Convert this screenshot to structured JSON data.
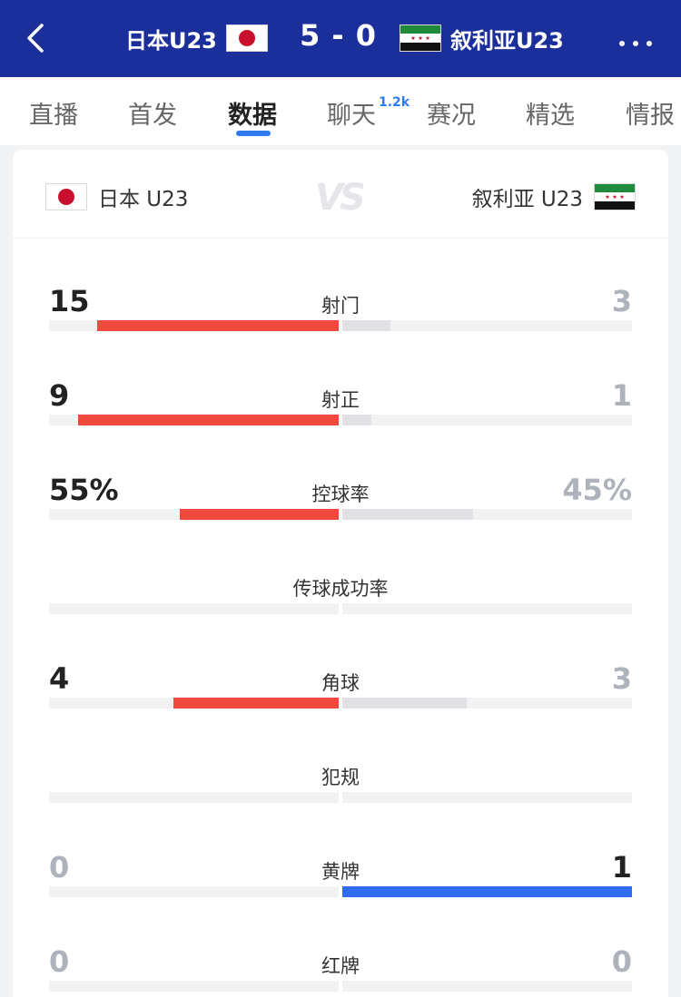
{
  "header": {
    "home_team": "日本U23",
    "away_team": "叙利亚U23",
    "score": "5 - 0",
    "icons": {
      "back": "back-arrow-icon",
      "more": "more-dots-icon"
    }
  },
  "tabs": [
    {
      "label": "直播"
    },
    {
      "label": "首发"
    },
    {
      "label": "数据",
      "active": true
    },
    {
      "label": "聊天",
      "badge": "1.2k"
    },
    {
      "label": "赛况"
    },
    {
      "label": "精选"
    },
    {
      "label": "情报"
    }
  ],
  "teams": {
    "home": "日本 U23",
    "away": "叙利亚 U23",
    "vs": "VS"
  },
  "colors": {
    "header": "#1b2f9a",
    "home_bar": "#ef4a3c",
    "away_bar": "#dfe1e5",
    "highlight_bar": "#2f6cf0",
    "tab_accent": "#2d7cf6"
  },
  "stats": [
    {
      "label": "射门",
      "home": "15",
      "away": "3",
      "home_frac": 0.833,
      "away_frac": 0.167
    },
    {
      "label": "射正",
      "home": "9",
      "away": "1",
      "home_frac": 0.9,
      "away_frac": 0.1
    },
    {
      "label": "控球率",
      "home": "55%",
      "away": "45%",
      "home_frac": 0.55,
      "away_frac": 0.45
    },
    {
      "label": "传球成功率",
      "home": "",
      "away": "",
      "home_frac": 0,
      "away_frac": 0
    },
    {
      "label": "角球",
      "home": "4",
      "away": "3",
      "home_frac": 0.571,
      "away_frac": 0.429
    },
    {
      "label": "犯规",
      "home": "",
      "away": "",
      "home_frac": 0,
      "away_frac": 0
    },
    {
      "label": "黄牌",
      "home": "0",
      "away": "1",
      "home_frac": 0,
      "away_frac": 1
    },
    {
      "label": "红牌",
      "home": "0",
      "away": "0",
      "home_frac": 0,
      "away_frac": 0
    }
  ]
}
